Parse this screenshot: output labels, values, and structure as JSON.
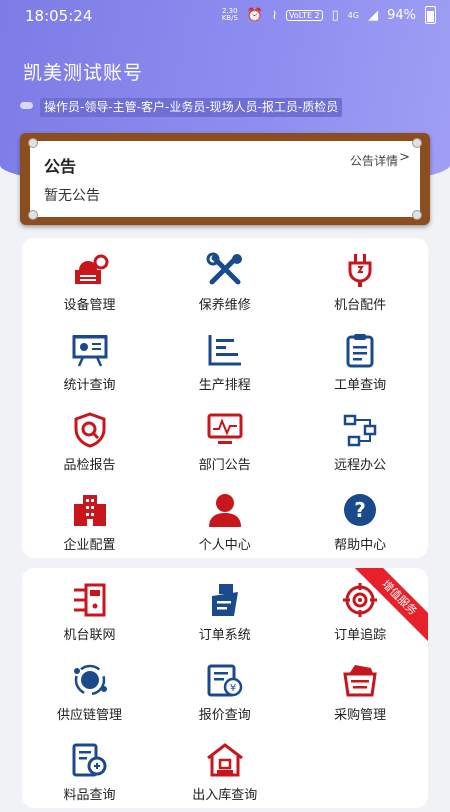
{
  "status_bar": {
    "time": "18:05:24",
    "net_speed_value": "2.30",
    "net_speed_unit": "KB/S",
    "volte": "VoLTE 2",
    "signal": "4G",
    "battery": "94%"
  },
  "header": {
    "account_name": "凯美测试账号",
    "roles": "操作员-领导-主管-客户-业务员-现场人员-报工员-质检员"
  },
  "notice": {
    "title": "公告",
    "detail_link": "公告详情",
    "chevron": ">",
    "body": "暂无公告"
  },
  "menu1": [
    {
      "label": "设备管理",
      "icon": "equipment-icon"
    },
    {
      "label": "保养维修",
      "icon": "tools-icon"
    },
    {
      "label": "机台配件",
      "icon": "plug-icon"
    },
    {
      "label": "统计查询",
      "icon": "board-chart-icon"
    },
    {
      "label": "生产排程",
      "icon": "schedule-icon"
    },
    {
      "label": "工单查询",
      "icon": "clipboard-icon"
    },
    {
      "label": "品检报告",
      "icon": "shield-search-icon"
    },
    {
      "label": "部门公告",
      "icon": "monitor-icon"
    },
    {
      "label": "远程办公",
      "icon": "network-icon"
    },
    {
      "label": "企业配置",
      "icon": "building-icon"
    },
    {
      "label": "个人中心",
      "icon": "person-icon"
    },
    {
      "label": "帮助中心",
      "icon": "help-icon"
    }
  ],
  "menu2": [
    {
      "label": "机台联网",
      "icon": "machine-link-icon"
    },
    {
      "label": "订单系统",
      "icon": "order-icon"
    },
    {
      "label": "订单追踪",
      "icon": "target-icon"
    },
    {
      "label": "供应链管理",
      "icon": "supply-chain-icon"
    },
    {
      "label": "报价查询",
      "icon": "quote-icon"
    },
    {
      "label": "采购管理",
      "icon": "purchase-icon"
    },
    {
      "label": "料品查询",
      "icon": "material-icon"
    },
    {
      "label": "出入库查询",
      "icon": "warehouse-icon"
    }
  ],
  "ribbon": "增值服务",
  "colors": {
    "red": "#c8161d",
    "navy": "#1b4a8c",
    "hero": "#8584ea"
  }
}
